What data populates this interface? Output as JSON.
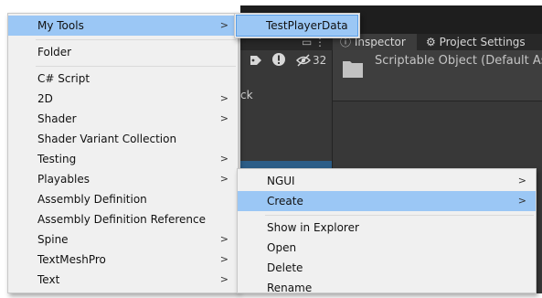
{
  "editor": {
    "inspector_tab": "Inspector",
    "project_settings_tab": "Project Settings",
    "inspector_title": "Scriptable Object (Default Ass",
    "hidden_count": "32",
    "fragment": "ck",
    "colors": {
      "dark_panel": "#383838",
      "tab_strip": "#282828",
      "selection": "#2c5d87"
    },
    "icons": [
      "tag-icon",
      "warning-icon",
      "hidden-eye-icon",
      "folder-icon",
      "gear-icon",
      "info-icon"
    ]
  },
  "main_menu": {
    "items": [
      {
        "label": "My Tools",
        "submenu": true,
        "selected": true
      },
      {
        "label": "Folder",
        "submenu": false
      },
      {
        "label": "C# Script",
        "submenu": false
      },
      {
        "label": "2D",
        "submenu": true
      },
      {
        "label": "Shader",
        "submenu": true
      },
      {
        "label": "Shader Variant Collection",
        "submenu": false
      },
      {
        "label": "Testing",
        "submenu": true
      },
      {
        "label": "Playables",
        "submenu": true
      },
      {
        "label": "Assembly Definition",
        "submenu": false
      },
      {
        "label": "Assembly Definition Reference",
        "submenu": false
      },
      {
        "label": "Spine",
        "submenu": true
      },
      {
        "label": "TextMeshPro",
        "submenu": true
      },
      {
        "label": "Text",
        "submenu": true
      }
    ],
    "arrow_glyph": ">"
  },
  "tools_submenu": {
    "items": [
      {
        "label": "TestPlayerData"
      }
    ]
  },
  "context_menu": {
    "items": [
      {
        "label": "NGUI",
        "submenu": true
      },
      {
        "label": "Create",
        "submenu": true,
        "selected": true
      },
      {
        "label": "Show in Explorer",
        "submenu": false
      },
      {
        "label": "Open",
        "submenu": false
      },
      {
        "label": "Delete",
        "submenu": false
      },
      {
        "label": "Rename",
        "submenu": false
      }
    ]
  },
  "menu_colors": {
    "background": "#f0f0f0",
    "highlight": "#9bc7f5"
  }
}
